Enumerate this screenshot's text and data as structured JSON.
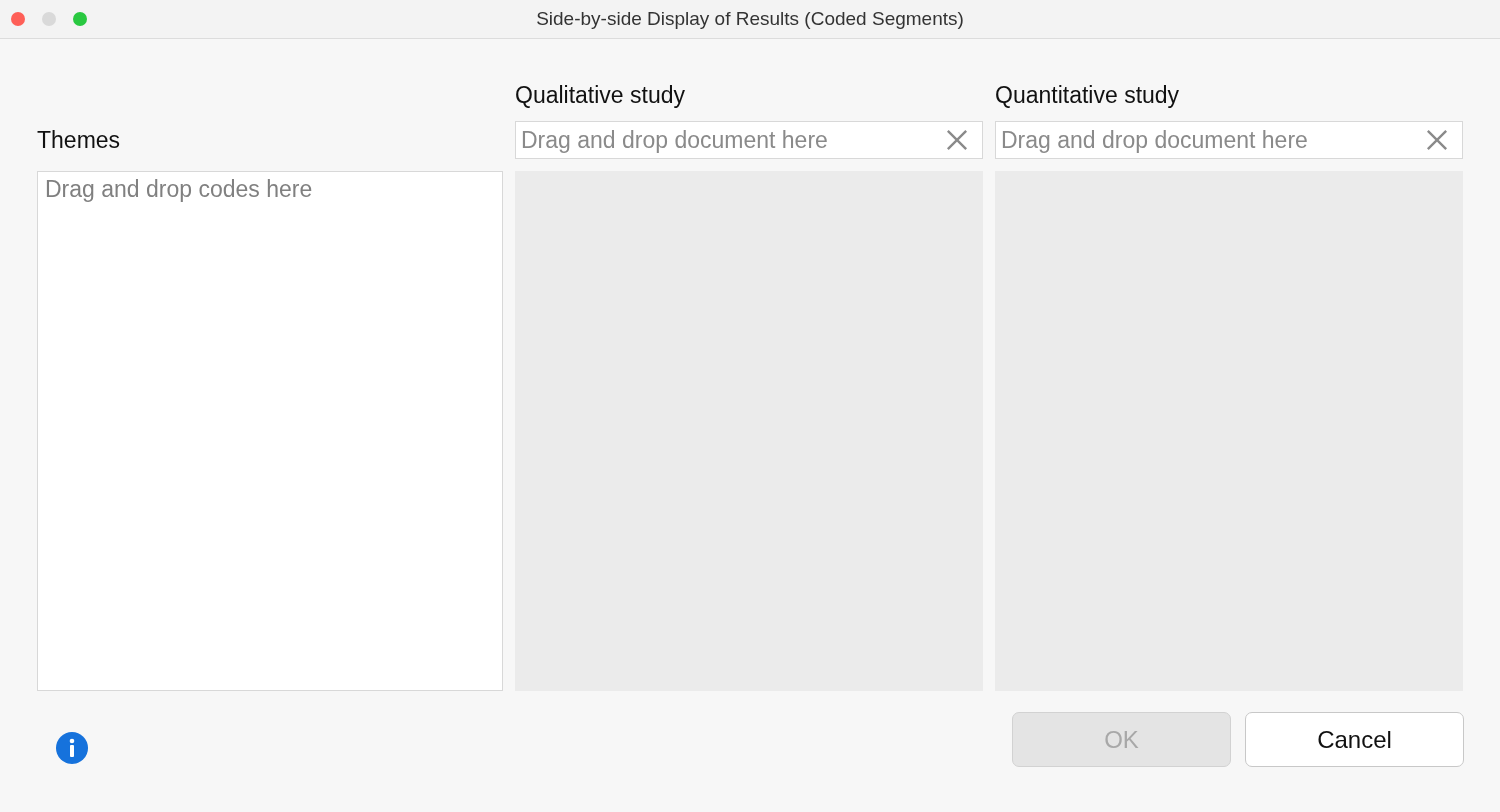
{
  "window": {
    "title": "Side-by-side Display of Results (Coded Segments)"
  },
  "themes": {
    "label": "Themes",
    "placeholder": "Drag and drop codes here"
  },
  "documents": [
    {
      "label": "Qualitative study",
      "placeholder": "Drag and drop document here"
    },
    {
      "label": "Quantitative study",
      "placeholder": "Drag and drop document here"
    }
  ],
  "buttons": [
    {
      "label": "OK",
      "disabled": true
    },
    {
      "label": "Cancel",
      "disabled": false
    }
  ]
}
